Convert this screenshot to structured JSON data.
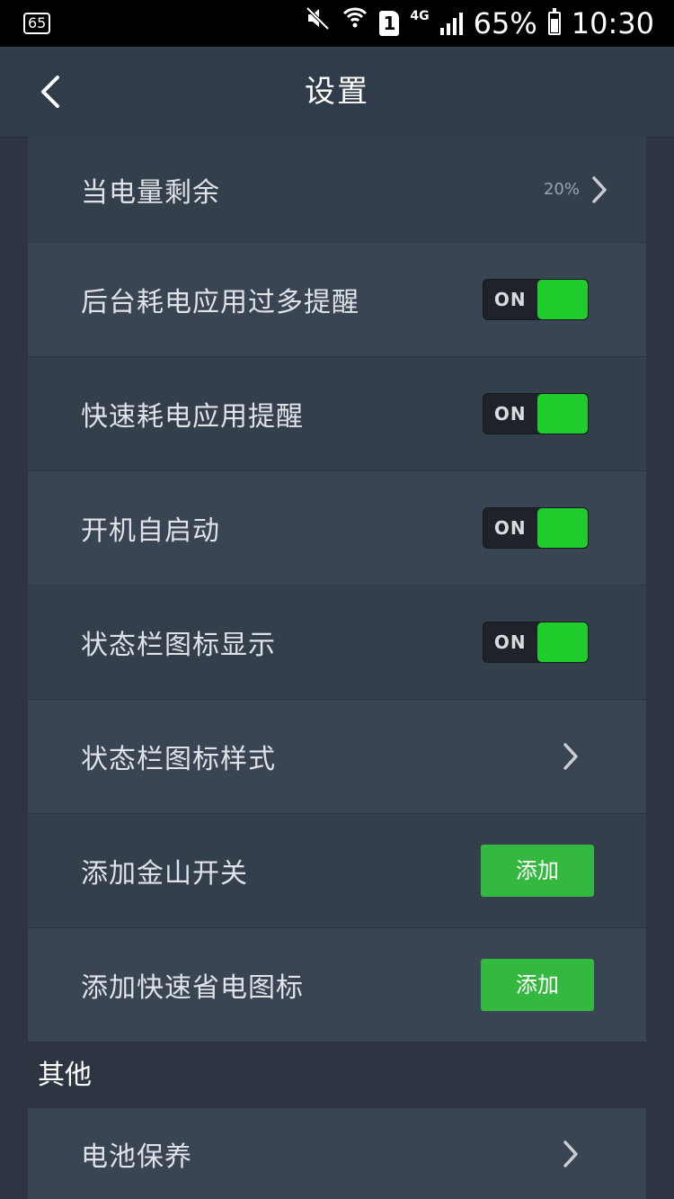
{
  "status_bar": {
    "left_badge": "65",
    "network": "4G",
    "sim": "1",
    "battery_percent": "65%",
    "time": "10:30"
  },
  "header": {
    "title": "设置"
  },
  "settings": {
    "battery_remaining": {
      "label": "当电量剩余",
      "value": "20%"
    },
    "background_drain_alert": {
      "label": "后台耗电应用过多提醒",
      "state": "ON"
    },
    "fast_drain_alert": {
      "label": "快速耗电应用提醒",
      "state": "ON"
    },
    "autostart": {
      "label": "开机自启动",
      "state": "ON"
    },
    "statusbar_icon_display": {
      "label": "状态栏图标显示",
      "state": "ON"
    },
    "statusbar_icon_style": {
      "label": "状态栏图标样式"
    },
    "add_kingsoft_switch": {
      "label": "添加金山开关",
      "button": "添加"
    },
    "add_power_save_icon": {
      "label": "添加快速省电图标",
      "button": "添加"
    }
  },
  "other": {
    "section_title": "其他",
    "battery_care": {
      "label": "电池保养"
    }
  },
  "colors": {
    "background": "#2c3541",
    "header": "#313c4a",
    "toggle_on": "#1fcc2c",
    "add_button": "#35b83f"
  }
}
